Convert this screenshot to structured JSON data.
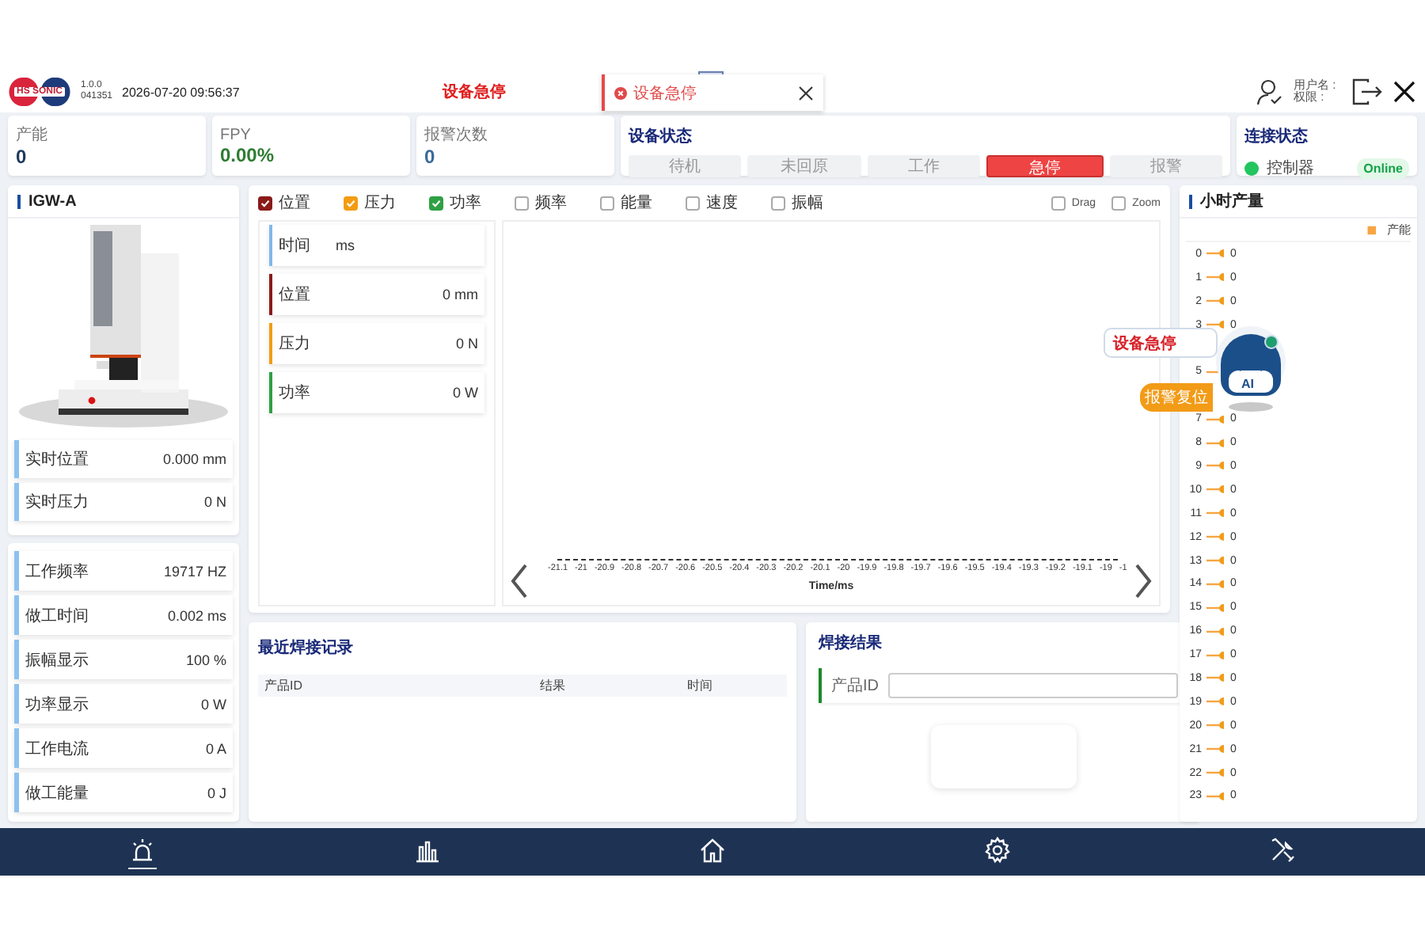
{
  "header": {
    "logo_text": "HS SONIC",
    "version": "1.0.0",
    "build": "041351",
    "datetime": "2026-07-20 09:56:37",
    "alert_title": "设备急停",
    "user_label": "用户名 :",
    "role_label": "权限 :"
  },
  "toast": {
    "message": "设备急停"
  },
  "stats": [
    {
      "label": "产能",
      "value": "0",
      "color": "#1f3a5f"
    },
    {
      "label": "FPY",
      "value": "0.00%",
      "color": "#2e7d32"
    },
    {
      "label": "报警次数",
      "value": "0",
      "color": "#3a6b9a"
    }
  ],
  "device_status": {
    "title": "设备状态",
    "states": [
      {
        "label": "待机",
        "selected": false
      },
      {
        "label": "未回原",
        "selected": false
      },
      {
        "label": "工作",
        "selected": false
      },
      {
        "label": "急停",
        "selected": true
      },
      {
        "label": "报警",
        "selected": false
      }
    ]
  },
  "connection": {
    "title": "连接状态",
    "items": [
      {
        "label": "控制器",
        "status": "Online",
        "on": true
      }
    ]
  },
  "machine": {
    "title": "IGW-A",
    "readings": [
      {
        "label": "实时位置",
        "value": "0.000",
        "unit": "mm"
      },
      {
        "label": "实时压力",
        "value": "0",
        "unit": "N"
      }
    ]
  },
  "process": {
    "readings": [
      {
        "label": "工作频率",
        "value": "19717",
        "unit": "HZ"
      },
      {
        "label": "做工时间",
        "value": "0.002",
        "unit": "ms"
      },
      {
        "label": "振幅显示",
        "value": "100",
        "unit": "%"
      },
      {
        "label": "功率显示",
        "value": "0",
        "unit": "W"
      },
      {
        "label": "工作电流",
        "value": "0",
        "unit": "A"
      },
      {
        "label": "做工能量",
        "value": "0",
        "unit": "J"
      }
    ]
  },
  "chart_panel": {
    "series_toggles": [
      {
        "label": "位置",
        "checked": true,
        "color": "#8b1a1a"
      },
      {
        "label": "压力",
        "checked": true,
        "color": "#f39c12"
      },
      {
        "label": "功率",
        "checked": true,
        "color": "#2ea043"
      },
      {
        "label": "频率",
        "checked": false
      },
      {
        "label": "能量",
        "checked": false
      },
      {
        "label": "速度",
        "checked": false
      },
      {
        "label": "振幅",
        "checked": false
      }
    ],
    "options": [
      {
        "label": "Drag",
        "checked": false
      },
      {
        "label": "Zoom",
        "checked": false
      }
    ],
    "readouts": [
      {
        "label": "时间",
        "unit": "ms",
        "color": "#7fb8ec"
      },
      {
        "label": "位置",
        "value": "0",
        "unit": "mm",
        "color": "#8b1a1a"
      },
      {
        "label": "压力",
        "value": "0",
        "unit": "N",
        "color": "#f39c12"
      },
      {
        "label": "功率",
        "value": "0",
        "unit": "W",
        "color": "#2ea043"
      }
    ],
    "chart": {
      "xlabel": "Time/ms",
      "xticks": [
        "-21.1",
        "-21",
        "-20.9",
        "-20.8",
        "-20.7",
        "-20.6",
        "-20.5",
        "-20.4",
        "-20.3",
        "-20.2",
        "-20.1",
        "-20",
        "-19.9",
        "-19.8",
        "-19.7",
        "-19.6",
        "-19.5",
        "-19.4",
        "-19.3",
        "-19.2",
        "-19.1",
        "-19",
        "-1"
      ]
    }
  },
  "records": {
    "title": "最近焊接记录",
    "columns": [
      "产品ID",
      "结果",
      "时间"
    ]
  },
  "weld_result": {
    "title": "焊接结果",
    "field_label": "产品ID"
  },
  "hourly": {
    "title": "小时产量",
    "legend": "产能",
    "rows": [
      {
        "kind": "row",
        "label": "0",
        "value": "0"
      },
      {
        "kind": "row",
        "label": "1",
        "value": "0"
      },
      {
        "kind": "row",
        "label": "2",
        "value": "0"
      },
      {
        "kind": "row",
        "label": "3",
        "value": "0"
      },
      {
        "kind": "covered"
      },
      {
        "kind": "row",
        "label": "5"
      },
      {
        "kind": "covered"
      },
      {
        "kind": "row",
        "label": "7",
        "value": "0"
      },
      {
        "kind": "row",
        "label": "8",
        "value": "0"
      },
      {
        "kind": "row",
        "label": "9",
        "value": "0"
      },
      {
        "kind": "row",
        "label": "10",
        "value": "0"
      },
      {
        "kind": "row",
        "label": "11",
        "value": "0"
      },
      {
        "kind": "row",
        "label": "12",
        "value": "0"
      },
      {
        "kind": "row",
        "label": "13",
        "value": "0"
      },
      {
        "kind": "row",
        "label": "14",
        "value": "0"
      },
      {
        "kind": "row",
        "label": "15",
        "value": "0"
      },
      {
        "kind": "row",
        "label": "16",
        "value": "0"
      },
      {
        "kind": "row",
        "label": "17",
        "value": "0"
      },
      {
        "kind": "row",
        "label": "18",
        "value": "0"
      },
      {
        "kind": "row",
        "label": "19",
        "value": "0"
      },
      {
        "kind": "row",
        "label": "20",
        "value": "0"
      },
      {
        "kind": "row",
        "label": "21",
        "value": "0"
      },
      {
        "kind": "row",
        "label": "22",
        "value": "0"
      },
      {
        "kind": "row",
        "label": "23",
        "value": "0"
      }
    ]
  },
  "assistant": {
    "bubble": "设备急停",
    "button": "报警复位",
    "badge": "AI"
  },
  "nav": [
    {
      "kind": "alarm",
      "selected": true
    },
    {
      "kind": "chart",
      "selected": false
    },
    {
      "kind": "home",
      "selected": false
    },
    {
      "kind": "settings",
      "selected": false
    },
    {
      "kind": "tools",
      "selected": false
    }
  ]
}
